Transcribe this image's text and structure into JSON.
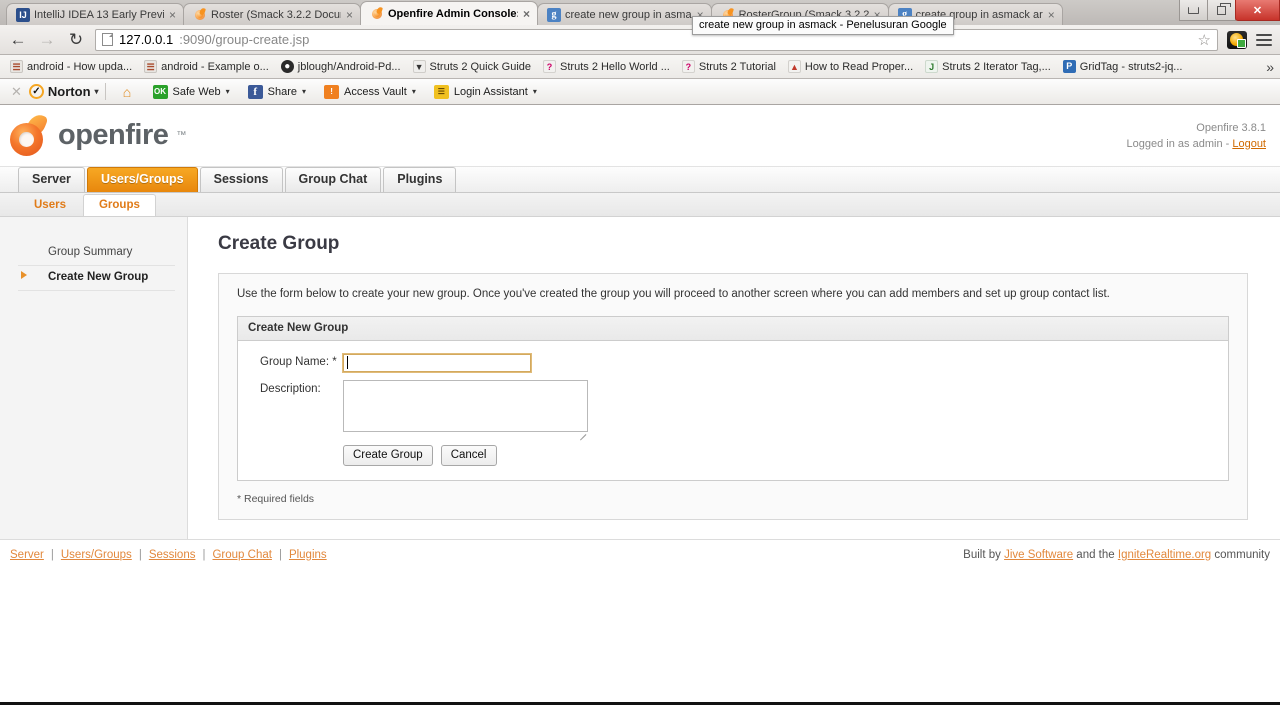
{
  "browser": {
    "tabs": [
      {
        "title": "IntelliJ IDEA 13 Early Previe",
        "icon": "intellij-favicon",
        "active": false,
        "close": "×"
      },
      {
        "title": "Roster (Smack 3.2.2 Docum",
        "icon": "openfire-favicon",
        "active": false,
        "close": "×"
      },
      {
        "title": "Openfire Admin Console:",
        "icon": "openfire-favicon",
        "active": true,
        "close": "×"
      },
      {
        "title": "create new group in asma",
        "icon": "google-favicon",
        "active": false,
        "close": "×"
      },
      {
        "title": "RosterGroup (Smack 3.2.2",
        "icon": "openfire-favicon",
        "active": false,
        "close": "×"
      },
      {
        "title": "create group in asmack ar",
        "icon": "google-favicon",
        "active": false,
        "close": "×"
      }
    ],
    "tab_tooltip": "create new group in asmack - Penelusuran Google",
    "window_controls": {
      "minimize": "minimize",
      "restore": "restore",
      "close": "✕"
    },
    "nav": {
      "back": "←",
      "forward": "→",
      "reload": "↻"
    },
    "omnibox": {
      "url_host": "127.0.0.1",
      "url_rest": ":9090/group-create.jsp",
      "full_url": "127.0.0.1:9090/group-create.jsp"
    },
    "bookmarks": [
      {
        "label": "android - How upda...",
        "icon": "android-doc-icon"
      },
      {
        "label": "android - Example o...",
        "icon": "android-doc-icon"
      },
      {
        "label": "jblough/Android-Pd...",
        "icon": "github-icon"
      },
      {
        "label": "Struts 2 Quick Guide",
        "icon": "struts-icon"
      },
      {
        "label": "Struts 2 Hello World ...",
        "icon": "question-icon"
      },
      {
        "label": "Struts 2 Tutorial",
        "icon": "question-icon"
      },
      {
        "label": "How to Read Proper...",
        "icon": "doc-icon"
      },
      {
        "label": "Struts 2 Iterator Tag,...",
        "icon": "java-icon"
      },
      {
        "label": "GridTag - struts2-jq...",
        "icon": "gridtag-icon"
      }
    ],
    "bookmarks_overflow": "»",
    "norton_toolbar": {
      "close_label": "✕",
      "brand": "Norton",
      "home_icon": "home-icon",
      "items": [
        {
          "label": "Safe Web",
          "icon": "safeweb-ok-icon",
          "caret": "▾"
        },
        {
          "label": "Share",
          "icon": "facebook-icon",
          "caret": "▾"
        },
        {
          "label": "Access Vault",
          "icon": "vault-icon",
          "caret": "▾"
        },
        {
          "label": "Login Assistant",
          "icon": "login-assistant-icon",
          "caret": "▾"
        }
      ],
      "brand_caret": "▾"
    }
  },
  "openfire": {
    "brand": {
      "name": "openfire",
      "tm": "™"
    },
    "user_info": {
      "version": "Openfire 3.8.1",
      "logged_in_prefix": "Logged in as admin - ",
      "logout": "Logout"
    },
    "tabs": [
      {
        "label": "Server",
        "active": false
      },
      {
        "label": "Users/Groups",
        "active": true
      },
      {
        "label": "Sessions",
        "active": false
      },
      {
        "label": "Group Chat",
        "active": false
      },
      {
        "label": "Plugins",
        "active": false
      }
    ],
    "subtabs": [
      {
        "label": "Users",
        "active": false
      },
      {
        "label": "Groups",
        "active": true
      }
    ],
    "sidebar": [
      {
        "label": "Group Summary",
        "active": false
      },
      {
        "label": "Create New Group",
        "active": true
      }
    ],
    "main": {
      "title": "Create Group",
      "description": "Use the form below to create your new group. Once you've created the group you will proceed to another screen where you can add members and set up group contact list.",
      "form": {
        "heading": "Create New Group",
        "group_name_label": "Group Name:",
        "required_marker": "*",
        "group_name_value": "",
        "description_label": "Description:",
        "description_value": "",
        "submit_label": "Create Group",
        "cancel_label": "Cancel"
      },
      "required_note": "* Required fields"
    },
    "footer": {
      "links": [
        {
          "label": "Server"
        },
        {
          "label": "Users/Groups"
        },
        {
          "label": "Sessions"
        },
        {
          "label": "Group Chat"
        },
        {
          "label": "Plugins"
        }
      ],
      "separator": "|",
      "credit_prefix": "Built by ",
      "credit_link1": "Jive Software",
      "credit_middle": " and the ",
      "credit_link2": "IgniteRealtime.org",
      "credit_suffix": " community"
    }
  }
}
